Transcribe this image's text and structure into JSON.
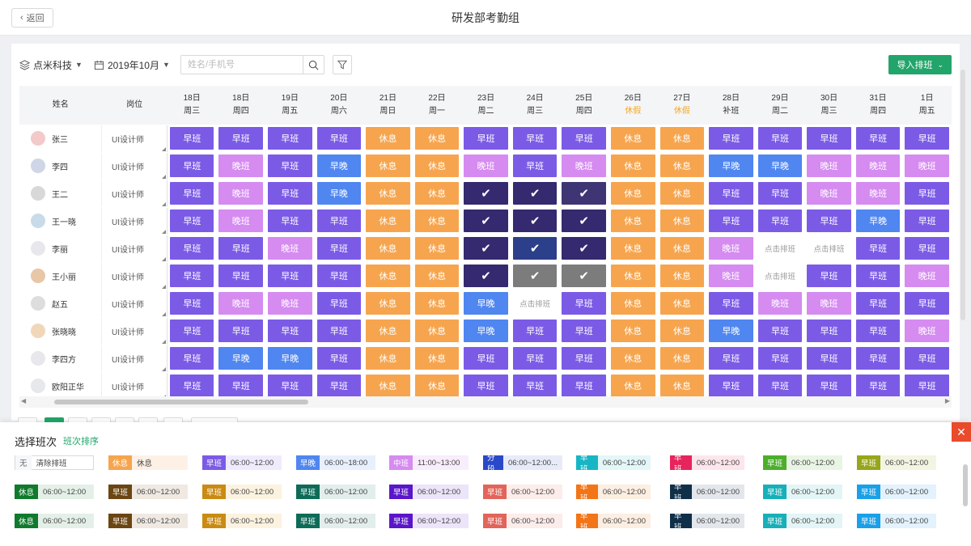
{
  "header": {
    "back_label": "返回",
    "title": "研发部考勤组"
  },
  "toolbar": {
    "company": "点米科技",
    "month": "2019年10月",
    "search_placeholder": "姓名/手机号",
    "import_label": "导入排班"
  },
  "grid": {
    "col_name": "姓名",
    "col_position": "岗位",
    "days": [
      {
        "date": "18日",
        "weekday": "周三",
        "holiday": false
      },
      {
        "date": "18日",
        "weekday": "周四",
        "holiday": false
      },
      {
        "date": "19日",
        "weekday": "周五",
        "holiday": false
      },
      {
        "date": "20日",
        "weekday": "周六",
        "holiday": false
      },
      {
        "date": "21日",
        "weekday": "周日",
        "holiday": false
      },
      {
        "date": "22日",
        "weekday": "周一",
        "holiday": false
      },
      {
        "date": "23日",
        "weekday": "周二",
        "holiday": false
      },
      {
        "date": "24日",
        "weekday": "周三",
        "holiday": false
      },
      {
        "date": "25日",
        "weekday": "周四",
        "holiday": false
      },
      {
        "date": "26日",
        "weekday": "休假",
        "holiday": true
      },
      {
        "date": "27日",
        "weekday": "休假",
        "holiday": true
      },
      {
        "date": "28日",
        "weekday": "补班",
        "holiday": false
      },
      {
        "date": "29日",
        "weekday": "周二",
        "holiday": false
      },
      {
        "date": "30日",
        "weekday": "周三",
        "holiday": false
      },
      {
        "date": "31日",
        "weekday": "周四",
        "holiday": false
      },
      {
        "date": "1日",
        "weekday": "周五",
        "holiday": false
      }
    ],
    "rows": [
      {
        "name": "张三",
        "position": "UI设计师",
        "avatar_color": "#f3c9c9",
        "shifts": [
          "早班",
          "早班",
          "早班",
          "早班",
          "休息",
          "休息",
          "早班",
          "早班",
          "早班",
          "休息",
          "休息",
          "早班",
          "早班",
          "早班",
          "早班",
          "早班"
        ]
      },
      {
        "name": "李四",
        "position": "UI设计师",
        "avatar_color": "#cfd6e6",
        "shifts": [
          "早班",
          "晚班",
          "早班",
          "早晚",
          "休息",
          "休息",
          "晚班",
          "早班",
          "晚班",
          "休息",
          "休息",
          "早晚",
          "早晚",
          "晚班",
          "晚班",
          "晚班"
        ]
      },
      {
        "name": "王二",
        "position": "UI设计师",
        "avatar_color": "#d8d8d8",
        "shifts": [
          "早班",
          "晚班",
          "早班",
          "早晚",
          "休息",
          "休息",
          "sel1",
          "sel1",
          "sel2",
          "休息",
          "休息",
          "早班",
          "早班",
          "晚班",
          "晚班",
          "早班"
        ]
      },
      {
        "name": "王一晓",
        "position": "UI设计师",
        "avatar_color": "#c9dbe9",
        "shifts": [
          "早班",
          "晚班",
          "早班",
          "早班",
          "休息",
          "休息",
          "sel1",
          "sel1",
          "sel1",
          "休息",
          "休息",
          "早班",
          "早班",
          "早班",
          "早晚",
          "早班"
        ]
      },
      {
        "name": "李丽",
        "position": "UI设计师",
        "avatar_color": "#e6e8ec",
        "shifts": [
          "早班",
          "早班",
          "晚班",
          "早班",
          "休息",
          "休息",
          "sel1",
          "sel4",
          "sel1",
          "休息",
          "休息",
          "晚班",
          "点击排班",
          "点击排班",
          "早班",
          "早班"
        ]
      },
      {
        "name": "王小丽",
        "position": "UI设计师",
        "avatar_color": "#e8c7a6",
        "shifts": [
          "早班",
          "早班",
          "早班",
          "早班",
          "休息",
          "休息",
          "sel1",
          "sel3",
          "sel3",
          "休息",
          "休息",
          "晚班",
          "点击排班",
          "早班",
          "早班",
          "晚班"
        ]
      },
      {
        "name": "赵五",
        "position": "UI设计师",
        "avatar_color": "#dddddd",
        "shifts": [
          "早班",
          "晚班",
          "晚班",
          "早班",
          "休息",
          "休息",
          "早晚",
          "点击排班",
          "早班",
          "休息",
          "休息",
          "早班",
          "晚班",
          "晚班",
          "早班",
          "早班"
        ]
      },
      {
        "name": "张晓晓",
        "position": "UI设计师",
        "avatar_color": "#f1d7b9",
        "shifts": [
          "早班",
          "早班",
          "早班",
          "早班",
          "休息",
          "休息",
          "早晚",
          "早班",
          "早班",
          "休息",
          "休息",
          "早晚",
          "早班",
          "早班",
          "早班",
          "晚班"
        ]
      },
      {
        "name": "李四方",
        "position": "UI设计师",
        "avatar_color": "#e6e8ec",
        "shifts": [
          "早班",
          "早晚",
          "早晚",
          "早班",
          "休息",
          "休息",
          "早班",
          "早班",
          "早班",
          "休息",
          "休息",
          "早班",
          "早班",
          "早班",
          "早班",
          "早班"
        ]
      },
      {
        "name": "欧阳正华",
        "position": "UI设计师",
        "avatar_color": "#e6e8ec",
        "shifts": [
          "早班",
          "早班",
          "早班",
          "早班",
          "休息",
          "休息",
          "早班",
          "早班",
          "早班",
          "休息",
          "休息",
          "早班",
          "早班",
          "早班",
          "早班",
          "早班"
        ]
      }
    ]
  },
  "panel": {
    "title": "选择班次",
    "sort_link": "班次排序",
    "rows": [
      [
        {
          "tag": "无",
          "time": "清除排班",
          "tag_color": "#f5f7fa",
          "tag_text": "#666",
          "bg": "#ffffff",
          "border": "#d9d9d9"
        },
        {
          "tag": "休息",
          "time": "休息",
          "tag_color": "#f6a54e",
          "bg": "#fdf1e6"
        },
        {
          "tag": "早班",
          "time": "06:00~12:00",
          "tag_color": "#7b5be6",
          "bg": "#efebfc"
        },
        {
          "tag": "早晚",
          "time": "06:00~18:00",
          "tag_color": "#4f86f0",
          "bg": "#e8f0fd"
        },
        {
          "tag": "中班",
          "time": "11:00~13:00",
          "tag_color": "#d58bf0",
          "bg": "#f8edfc"
        },
        {
          "tag": "分段",
          "time": "06:00~12:00...",
          "tag_color": "#2a49c9",
          "bg": "#e7ebf9"
        },
        {
          "tag": "早班",
          "time": "06:00~12:00",
          "tag_color": "#18b6c4",
          "bg": "#e3f6f8"
        },
        {
          "tag": "早班",
          "time": "06:00~12:00",
          "tag_color": "#e8245c",
          "bg": "#fce6ec"
        },
        {
          "tag": "早班",
          "time": "06:00~12:00",
          "tag_color": "#4caf2a",
          "bg": "#e9f5e4"
        },
        {
          "tag": "早班",
          "time": "06:00~12:00",
          "tag_color": "#97a61a",
          "bg": "#f3f5e2"
        }
      ],
      [
        {
          "tag": "休息",
          "time": "06:00~12:00",
          "tag_color": "#107a2d",
          "bg": "#e4f0e7"
        },
        {
          "tag": "早班",
          "time": "06:00~12:00",
          "tag_color": "#6b4512",
          "bg": "#efe9e2"
        },
        {
          "tag": "早班",
          "time": "06:00~12:00",
          "tag_color": "#c98b13",
          "bg": "#fbf2e0"
        },
        {
          "tag": "早班",
          "time": "06:00~12:00",
          "tag_color": "#0d6b57",
          "bg": "#e2eeeb"
        },
        {
          "tag": "早班",
          "time": "06:00~12:00",
          "tag_color": "#5a16c9",
          "bg": "#ece4f9"
        },
        {
          "tag": "早班",
          "time": "06:00~12:00",
          "tag_color": "#e2645a",
          "bg": "#fcecea"
        },
        {
          "tag": "早班",
          "time": "06:00~12:00",
          "tag_color": "#f27518",
          "bg": "#fdeee2"
        },
        {
          "tag": "早班",
          "time": "06:00~12:00",
          "tag_color": "#10304a",
          "bg": "#e3e7ec"
        },
        {
          "tag": "早班",
          "time": "06:00~12:00",
          "tag_color": "#18b0b8",
          "bg": "#e3f5f6"
        },
        {
          "tag": "早班",
          "time": "06:00~12:00",
          "tag_color": "#1aa0e8",
          "bg": "#e3f2fc"
        }
      ],
      [
        {
          "tag": "休息",
          "time": "06:00~12:00",
          "tag_color": "#107a2d",
          "bg": "#e4f0e7"
        },
        {
          "tag": "早班",
          "time": "06:00~12:00",
          "tag_color": "#6b4512",
          "bg": "#efe9e2"
        },
        {
          "tag": "早班",
          "time": "06:00~12:00",
          "tag_color": "#c98b13",
          "bg": "#fbf2e0"
        },
        {
          "tag": "早班",
          "time": "06:00~12:00",
          "tag_color": "#0d6b57",
          "bg": "#e2eeeb"
        },
        {
          "tag": "早班",
          "time": "06:00~12:00",
          "tag_color": "#5a16c9",
          "bg": "#ece4f9"
        },
        {
          "tag": "早班",
          "time": "06:00~12:00",
          "tag_color": "#e2645a",
          "bg": "#fcecea"
        },
        {
          "tag": "早班",
          "time": "06:00~12:00",
          "tag_color": "#f27518",
          "bg": "#fdeee2"
        },
        {
          "tag": "早班",
          "time": "06:00~12:00",
          "tag_color": "#10304a",
          "bg": "#e3e7ec"
        },
        {
          "tag": "早班",
          "time": "06:00~12:00",
          "tag_color": "#18b0b8",
          "bg": "#e3f5f6"
        },
        {
          "tag": "早班",
          "time": "06:00~12:00",
          "tag_color": "#1aa0e8",
          "bg": "#e3f2fc"
        }
      ]
    ]
  },
  "colors": {
    "accent": "#22a56a",
    "close": "#e94b2b"
  }
}
